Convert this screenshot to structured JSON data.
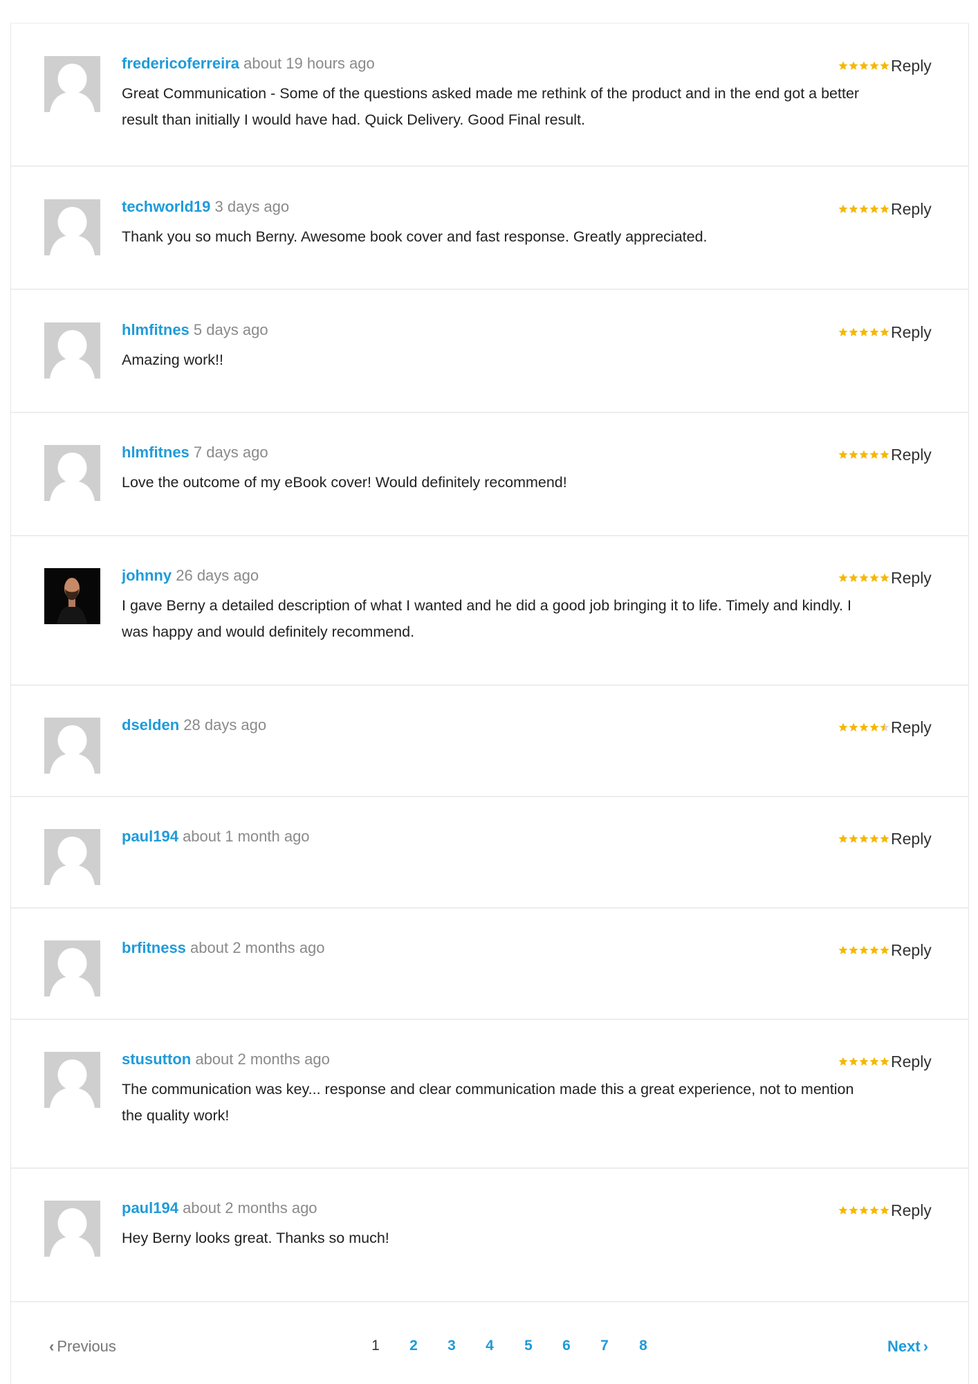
{
  "reviews": [
    {
      "user": "fredericoferreira",
      "time": "about 19 hours ago",
      "text": "Great Communication - Some of the questions asked made me rethink of the product and in the end got a better result than initially I would have had. Quick Delivery. Good Final result.",
      "rating": 5,
      "reply": "Reply",
      "avatar": "default-avatar"
    },
    {
      "user": "techworld19",
      "time": "3 days ago",
      "text": "Thank you so much Berny. Awesome book cover and fast response. Greatly appreciated.",
      "rating": 5,
      "reply": "Reply",
      "avatar": "default-avatar"
    },
    {
      "user": "hlmfitnes",
      "time": "5 days ago",
      "text": "Amazing work!!",
      "rating": 5,
      "reply": "Reply",
      "avatar": "default-avatar"
    },
    {
      "user": "hlmfitnes",
      "time": "7 days ago",
      "text": "Love the outcome of my eBook cover! Would definitely recommend!",
      "rating": 5,
      "reply": "Reply",
      "avatar": "default-avatar"
    },
    {
      "user": "johnny",
      "time": "26 days ago",
      "text": "I gave Berny a detailed description of what I wanted and he did a good job bringing it to life. Timely and kindly. I was happy and would definitely recommend.",
      "rating": 5,
      "reply": "Reply",
      "avatar": "photo-avatar"
    },
    {
      "user": "dselden",
      "time": "28 days ago",
      "text": "",
      "rating": 4.5,
      "reply": "Reply",
      "avatar": "default-avatar"
    },
    {
      "user": "paul194",
      "time": "about 1 month ago",
      "text": "",
      "rating": 5,
      "reply": "Reply",
      "avatar": "default-avatar"
    },
    {
      "user": "brfitness",
      "time": "about 2 months ago",
      "text": "",
      "rating": 5,
      "reply": "Reply",
      "avatar": "default-avatar"
    },
    {
      "user": "stusutton",
      "time": "about 2 months ago",
      "text": "The communication was key... response and clear communication made this a great experience, not to mention the quality work!",
      "rating": 5,
      "reply": "Reply",
      "avatar": "default-avatar"
    },
    {
      "user": "paul194",
      "time": "about 2 months ago",
      "text": "Hey Berny looks great. Thanks so much!",
      "rating": 5,
      "reply": "Reply",
      "avatar": "default-avatar"
    }
  ],
  "pagination": {
    "previous": "Previous",
    "next": "Next",
    "pages": [
      "1",
      "2",
      "3",
      "4",
      "5",
      "6",
      "7",
      "8"
    ],
    "current": "1"
  },
  "colors": {
    "username": "#1f9bd9",
    "star": "#f5b800",
    "star_empty": "#d9d9d9"
  }
}
